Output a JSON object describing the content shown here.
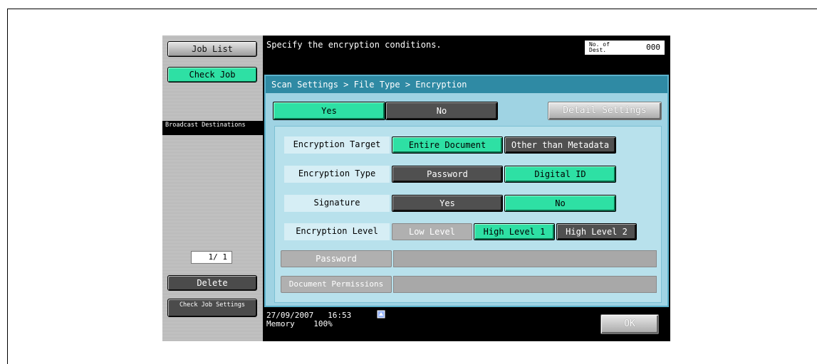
{
  "left_panel": {
    "job_list": "Job List",
    "check_job": "Check Job",
    "broadcast": "Broadcast Destinations",
    "page_count": "1/  1",
    "delete": "Delete",
    "check_job_settings": "Check Job Settings"
  },
  "header": {
    "message": "Specify the encryption conditions.",
    "dest_label": "No. of Dest.",
    "dest_count": "000"
  },
  "breadcrumb": "Scan Settings > File Type > Encryption",
  "enc_toggle": {
    "yes": "Yes",
    "no": "No",
    "selected": "Yes"
  },
  "detail_settings": "Detail Settings",
  "rows": {
    "target": {
      "label": "Encryption Target",
      "options": [
        "Entire Document",
        "Other than Metadata"
      ],
      "selected": "Entire Document"
    },
    "type": {
      "label": "Encryption Type",
      "options": [
        "Password",
        "Digital ID"
      ],
      "selected": "Digital ID"
    },
    "signature": {
      "label": "Signature",
      "options": [
        "Yes",
        "No"
      ],
      "selected": "No"
    },
    "level": {
      "label": "Encryption Level",
      "options": [
        "Low Level",
        "High Level 1",
        "High Level 2"
      ],
      "selected": "High Level 1"
    }
  },
  "password_btn": "Password",
  "doc_permissions_btn": "Document Permissions",
  "status": {
    "date": "27/09/2007",
    "time": "16:53",
    "memory_label": "Memory",
    "memory_value": "100%"
  },
  "ok": "OK",
  "colors": {
    "selected_green": "#2ee0a4",
    "panel_blue": "#9fd3e3",
    "header_blue": "#2f8aa4"
  }
}
